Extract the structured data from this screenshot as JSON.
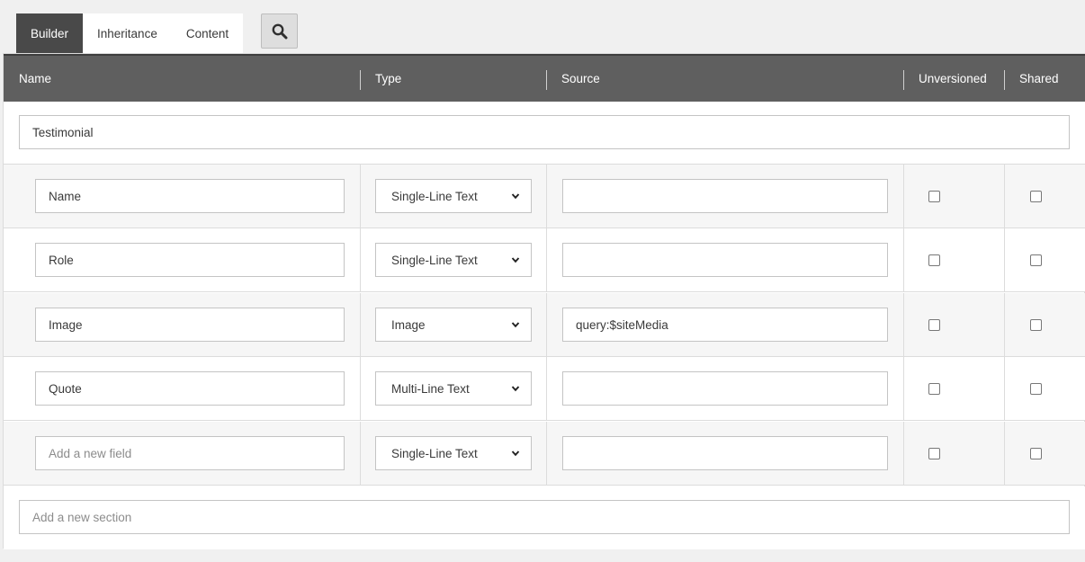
{
  "tabs": [
    {
      "label": "Builder",
      "active": true
    },
    {
      "label": "Inheritance",
      "active": false
    },
    {
      "label": "Content",
      "active": false
    }
  ],
  "columns": {
    "name": "Name",
    "type": "Type",
    "source": "Source",
    "unversioned": "Unversioned",
    "shared": "Shared"
  },
  "section": {
    "value": "Testimonial"
  },
  "fields": [
    {
      "name": "Name",
      "type": "Single-Line Text",
      "source": "",
      "unversioned": false,
      "shared": false
    },
    {
      "name": "Role",
      "type": "Single-Line Text",
      "source": "",
      "unversioned": false,
      "shared": false
    },
    {
      "name": "Image",
      "type": "Image",
      "source": "query:$siteMedia",
      "unversioned": false,
      "shared": false
    },
    {
      "name": "Quote",
      "type": "Multi-Line Text",
      "source": "",
      "unversioned": false,
      "shared": false
    }
  ],
  "new_field": {
    "placeholder": "Add a new field",
    "type": "Single-Line Text",
    "source": ""
  },
  "new_section": {
    "placeholder": "Add a new section"
  },
  "icons": {
    "search": "search-icon",
    "dropdown": "chevron-down-icon"
  },
  "colors": {
    "header_bg": "#5f5f5f",
    "active_tab_bg": "#494949"
  }
}
